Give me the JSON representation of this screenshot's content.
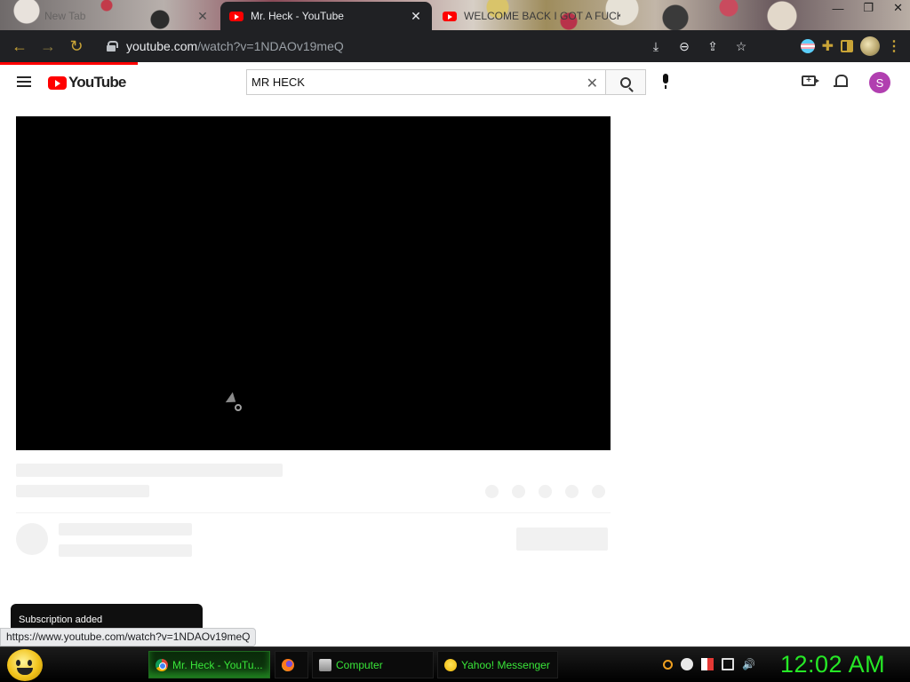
{
  "browser": {
    "tabs": [
      {
        "label": "New Tab",
        "active": false
      },
      {
        "label": "Mr. Heck - YouTube",
        "active": true,
        "icon": "youtube-icon"
      },
      {
        "label": "WELCOME BACK I GOT A FUCK",
        "active": false,
        "icon": "youtube-icon"
      }
    ],
    "url_host": "youtube.com",
    "url_path": "/watch?v=1NDAOv19meQ",
    "accent_color": "#c9a437"
  },
  "youtube": {
    "logo_text": "YouTube",
    "search_value": "MR HECK",
    "avatar_letter": "S",
    "avatar_color": "#b13fb0"
  },
  "toast": {
    "text": "Subscription added"
  },
  "status_url": "https://www.youtube.com/watch?v=1NDAOv19meQ",
  "taskbar": {
    "items": [
      {
        "label": "Mr. Heck - YouTu...",
        "icon": "chrome-icon",
        "active": true
      },
      {
        "label": "",
        "icon": "firefox-icon",
        "active": false
      },
      {
        "label": "Computer",
        "icon": "computer-icon",
        "active": false
      },
      {
        "label": "Yahoo! Messenger",
        "icon": "yahoo-messenger-icon",
        "active": false
      }
    ],
    "clock": "12:02 AM",
    "accent_color": "#26e826"
  }
}
